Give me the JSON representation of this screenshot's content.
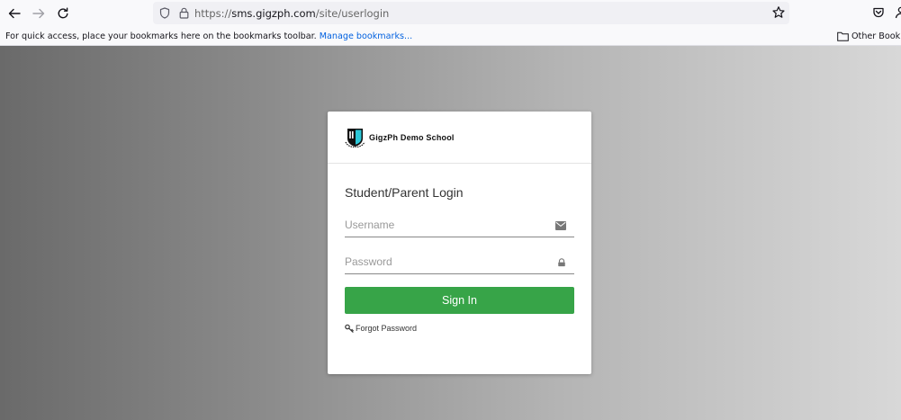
{
  "browser": {
    "url_prefix": "https://",
    "url_host": "sms.gigzph.com",
    "url_path": "/site/userlogin",
    "bookmarks_message": "For quick access, place your bookmarks here on the bookmarks toolbar.",
    "manage_bookmarks": "Manage bookmarks...",
    "other_bookmarks": "Other Bookmarks"
  },
  "login": {
    "school_name": "GigzPh Demo School",
    "title": "Student/Parent Login",
    "username_placeholder": "Username",
    "password_placeholder": "Password",
    "signin_label": "Sign In",
    "forgot_label": "Forgot Password"
  },
  "colors": {
    "signin_button": "#37a448",
    "link": "#0060df"
  }
}
